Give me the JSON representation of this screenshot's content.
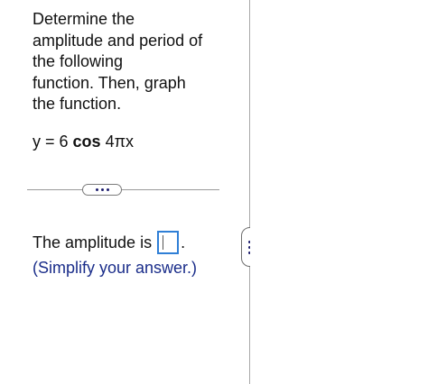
{
  "question": {
    "prompt": "Determine the\namplitude and period of\nthe following\nfunction. Then, graph\nthe function.",
    "equation": {
      "lhs": "y = 6 ",
      "func": "cos",
      "arg": " 4πx"
    }
  },
  "answer": {
    "amplitude_label": "The amplitude is",
    "amplitude_value": "",
    "period_mark": ".",
    "hint": "(Simplify your answer.)"
  },
  "icons": {
    "more": "ellipsis-icon",
    "splitter": "vertical-ellipsis-icon"
  },
  "colors": {
    "input_border": "#2f7fd6",
    "hint_text": "#1a2d8a"
  }
}
